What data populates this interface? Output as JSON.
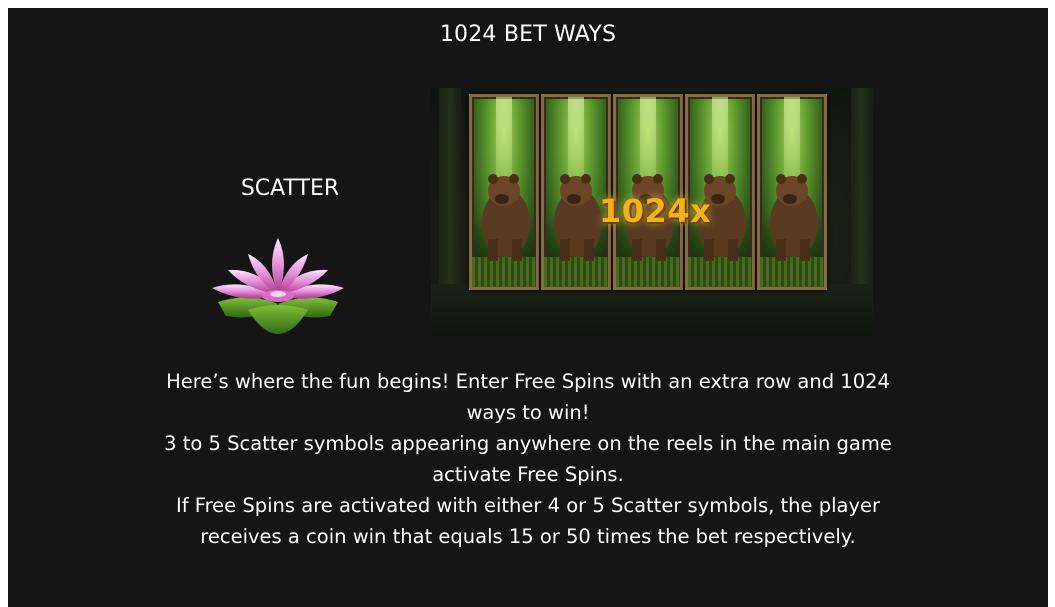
{
  "title": "1024 BET WAYS",
  "scatter": {
    "label": "SCATTER",
    "icon": "lotus-flower-icon"
  },
  "reels": {
    "count": 5,
    "symbol": "bear",
    "multiplier": "1024x"
  },
  "description": {
    "paragraphs": [
      "Here’s where the fun begins! Enter Free Spins with an extra row and 1024 ways to win!",
      "3 to 5 Scatter symbols appearing anywhere on the reels in the main game activate Free Spins.",
      "If Free Spins are activated with either 4 or 5 Scatter symbols, the player receives a coin win that equals 15 or 50 times the bet respectively."
    ]
  },
  "colors": {
    "background": "#151515",
    "text": "#ffffff",
    "multiplier": "#f2b21a",
    "reel_frame": "#8a6a44"
  }
}
